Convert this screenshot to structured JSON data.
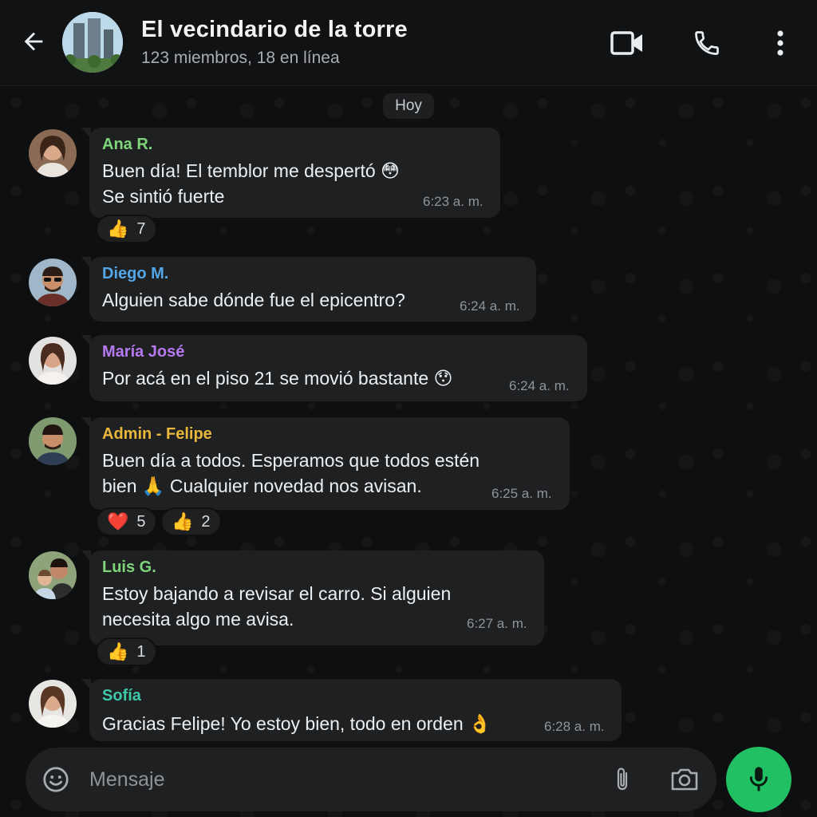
{
  "header": {
    "title": "El vecindario de la torre",
    "subtitle": "123 miembros, 18 en línea",
    "icons": [
      "back-arrow-icon",
      "video-call-icon",
      "phone-icon",
      "more-vert-icon"
    ]
  },
  "chat": {
    "date_label": "Hoy",
    "messages": [
      {
        "sender": "Ana R.",
        "sender_color": "#7fd67a",
        "lines": [
          "Buen día! El temblor me despertó 😳",
          "Se sintió fuerte"
        ],
        "time": "6:23 a. m.",
        "reactions": [
          {
            "emoji": "👍",
            "count": "7"
          }
        ]
      },
      {
        "sender": "Diego M.",
        "sender_color": "#53a6e8",
        "lines": [
          "Alguien sabe dónde fue el epicentro?"
        ],
        "time": "6:24 a. m.",
        "reactions": []
      },
      {
        "sender": "María José",
        "sender_color": "#b679f0",
        "lines": [
          "Por acá en el piso 21 se movió bastante 😯"
        ],
        "time": "6:24 a. m.",
        "reactions": []
      },
      {
        "sender": "Admin - Felipe",
        "sender_color": "#e8b73c",
        "lines": [
          "Buen día a todos. Esperamos que todos estén",
          "bien 🙏 Cualquier novedad nos avisan."
        ],
        "time": "6:25 a. m.",
        "reactions": [
          {
            "emoji": "❤️",
            "count": "5"
          },
          {
            "emoji": "👍",
            "count": "2"
          }
        ]
      },
      {
        "sender": "Luis G.",
        "sender_color": "#7fd67a",
        "lines": [
          "Estoy bajando a revisar el carro. Si alguien",
          "necesita algo me avisa."
        ],
        "time": "6:27 a. m.",
        "reactions": [
          {
            "emoji": "👍",
            "count": "1"
          }
        ]
      },
      {
        "sender": "Sofía",
        "sender_color": "#3fc7a8",
        "lines": [
          "Gracias Felipe! Yo estoy bien, todo en orden 👌"
        ],
        "time": "6:28 a. m.",
        "reactions": []
      }
    ]
  },
  "composer": {
    "placeholder": "Mensaje",
    "icons": [
      "emoji-icon",
      "attach-icon",
      "camera-icon",
      "mic-icon"
    ],
    "accent": "#21c063"
  }
}
